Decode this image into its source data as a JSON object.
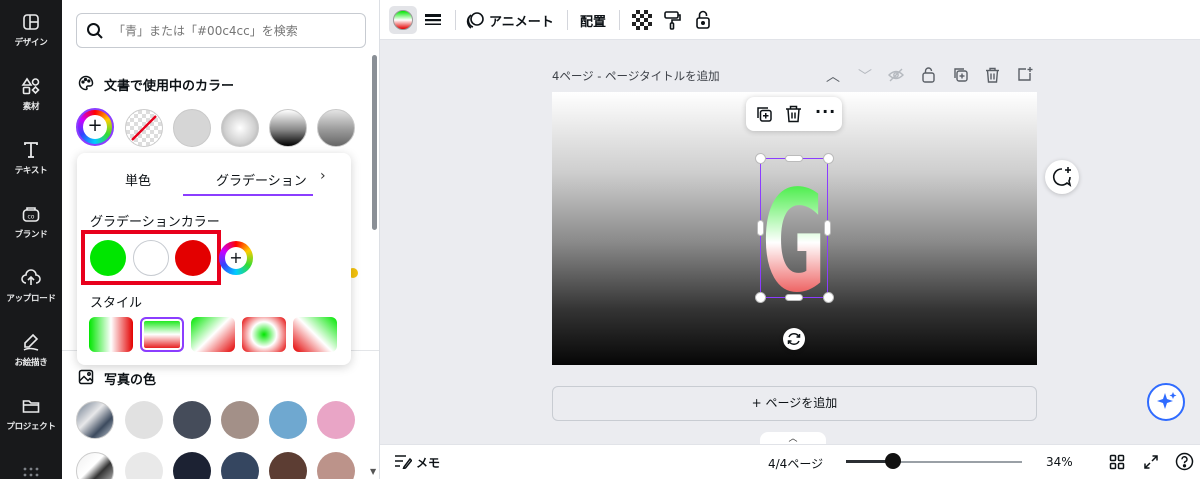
{
  "sidebar": {
    "items": [
      {
        "label": "デザイン",
        "icon": "layout-icon"
      },
      {
        "label": "素材",
        "icon": "shapes-icon"
      },
      {
        "label": "テキスト",
        "icon": "text-icon"
      },
      {
        "label": "ブランド",
        "icon": "brand-icon"
      },
      {
        "label": "アップロード",
        "icon": "upload-icon"
      },
      {
        "label": "お絵描き",
        "icon": "draw-icon"
      },
      {
        "label": "プロジェクト",
        "icon": "folder-icon"
      }
    ]
  },
  "panel": {
    "search_placeholder": "「青」または「#00c4cc」を検索",
    "doc_colors_title": "文書で使用中のカラー",
    "photo_colors_title": "写真の色",
    "doc_colors": [
      "add",
      "transparent",
      "#d6d6d6",
      "radial-gray",
      "linear-dark",
      "linear-mid"
    ],
    "photo_colors_row1": [
      "photo",
      "#e1e1e1",
      "#454c5a",
      "#a39088",
      "#6fa8d0",
      "#e9a5c6"
    ],
    "photo_colors_row2": [
      "photo",
      "#e9e9e9",
      "#1c2233",
      "#354660",
      "#5c3d33",
      "#bc938a"
    ]
  },
  "popup": {
    "tab_solid": "単色",
    "tab_gradient": "グラデーション",
    "gradient_colors_label": "グラデーションカラー",
    "gradient_colors": [
      "#00e600",
      "#ffffff",
      "#e30000"
    ],
    "style_label": "スタイル"
  },
  "topbar": {
    "animate_label": "アニメート",
    "position_label": "配置"
  },
  "canvas": {
    "page_title": "4ページ - ページタイトルを追加",
    "letter": "G",
    "add_page_label": "+ ページを追加"
  },
  "bottombar": {
    "memo_label": "メモ",
    "page_count": "4/4ページ",
    "zoom_percent": 34,
    "zoom_label": "34%"
  },
  "colors": {
    "accent": "#8b3dff",
    "highlight": "#e8001c",
    "sidebar_bg": "#18191b"
  }
}
